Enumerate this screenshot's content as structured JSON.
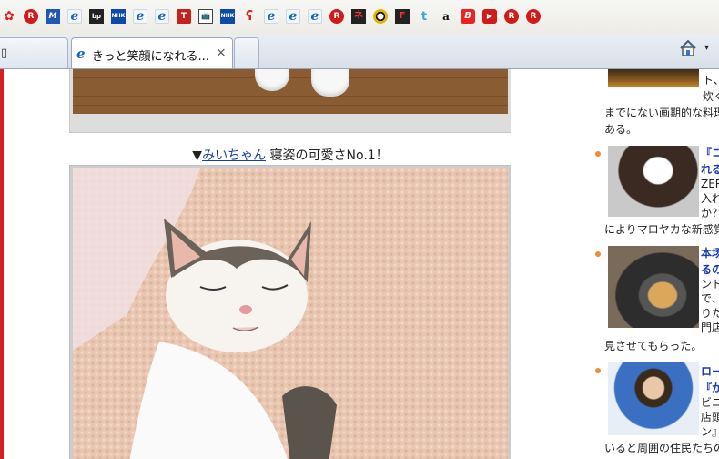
{
  "favorites_bar": [
    {
      "icon": "swirl-icon",
      "glyph": "✿"
    },
    {
      "icon": "rakuten-r-icon",
      "glyph": "R"
    },
    {
      "icon": "m-logo-icon",
      "glyph": "M"
    },
    {
      "icon": "ie-page-icon",
      "glyph": "e"
    },
    {
      "icon": "bp-logo-icon",
      "glyph": "bp"
    },
    {
      "icon": "nhk-icon",
      "glyph": "NHK"
    },
    {
      "icon": "ie-page-icon",
      "glyph": "e"
    },
    {
      "icon": "ie-page-icon",
      "glyph": "e"
    },
    {
      "icon": "red-t-icon",
      "glyph": "T"
    },
    {
      "icon": "tv-icon",
      "glyph": "📺"
    },
    {
      "icon": "nhk-icon",
      "glyph": "NHK"
    },
    {
      "icon": "swirl-red-icon",
      "glyph": "ʕ"
    },
    {
      "icon": "ie-page-icon",
      "glyph": "e"
    },
    {
      "icon": "ie-page-icon",
      "glyph": "e"
    },
    {
      "icon": "ie-page-icon",
      "glyph": "e"
    },
    {
      "icon": "rakuten-r-icon",
      "glyph": "R"
    },
    {
      "icon": "ne-icon",
      "glyph": "ネ"
    },
    {
      "icon": "ball-icon",
      "glyph": ""
    },
    {
      "icon": "magazine-f-icon",
      "glyph": "F"
    },
    {
      "icon": "twitter-icon",
      "glyph": "t"
    },
    {
      "icon": "amazon-icon",
      "glyph": "a"
    },
    {
      "icon": "bold-b-icon",
      "glyph": "B"
    },
    {
      "icon": "youtube-icon",
      "glyph": "▶"
    },
    {
      "icon": "rakuten-r-icon",
      "glyph": "R"
    },
    {
      "icon": "rakuten-r-icon",
      "glyph": "R"
    }
  ],
  "tabs": {
    "active_title": "きっと笑顔になれる...",
    "close_glyph": "×"
  },
  "caption": {
    "prefix": "▼",
    "name": "みいちゃん",
    "text": " 寝姿の可愛さNo.1！"
  },
  "sidebar": {
    "item1": {
      "line1": "ト、",
      "line2": "炊く",
      "line3": "までにない画期的な料理",
      "line4": "ある。"
    },
    "item2": {
      "title1": "『コ",
      "title2": "れる",
      "line1": "ZER",
      "line2": "入れ",
      "line3": "か？",
      "line4": "によりマロヤカな新感覚コ"
    },
    "item3": {
      "title1": "本场",
      "title2": "るの",
      "line1": "ンド",
      "line2": "で、",
      "line3": "りた",
      "line4": "門店",
      "line5": "見させてもらった。"
    },
    "item4": {
      "title1": "ロー",
      "title2": "『か",
      "line1": "ビニ",
      "line2": "店頭",
      "line3": "ン』",
      "line4": "いると周囲の住民たちの"
    }
  },
  "colors": {
    "accent_red": "#d42020",
    "link_blue": "#1a3ca6",
    "bullet_orange": "#f08a3a"
  }
}
